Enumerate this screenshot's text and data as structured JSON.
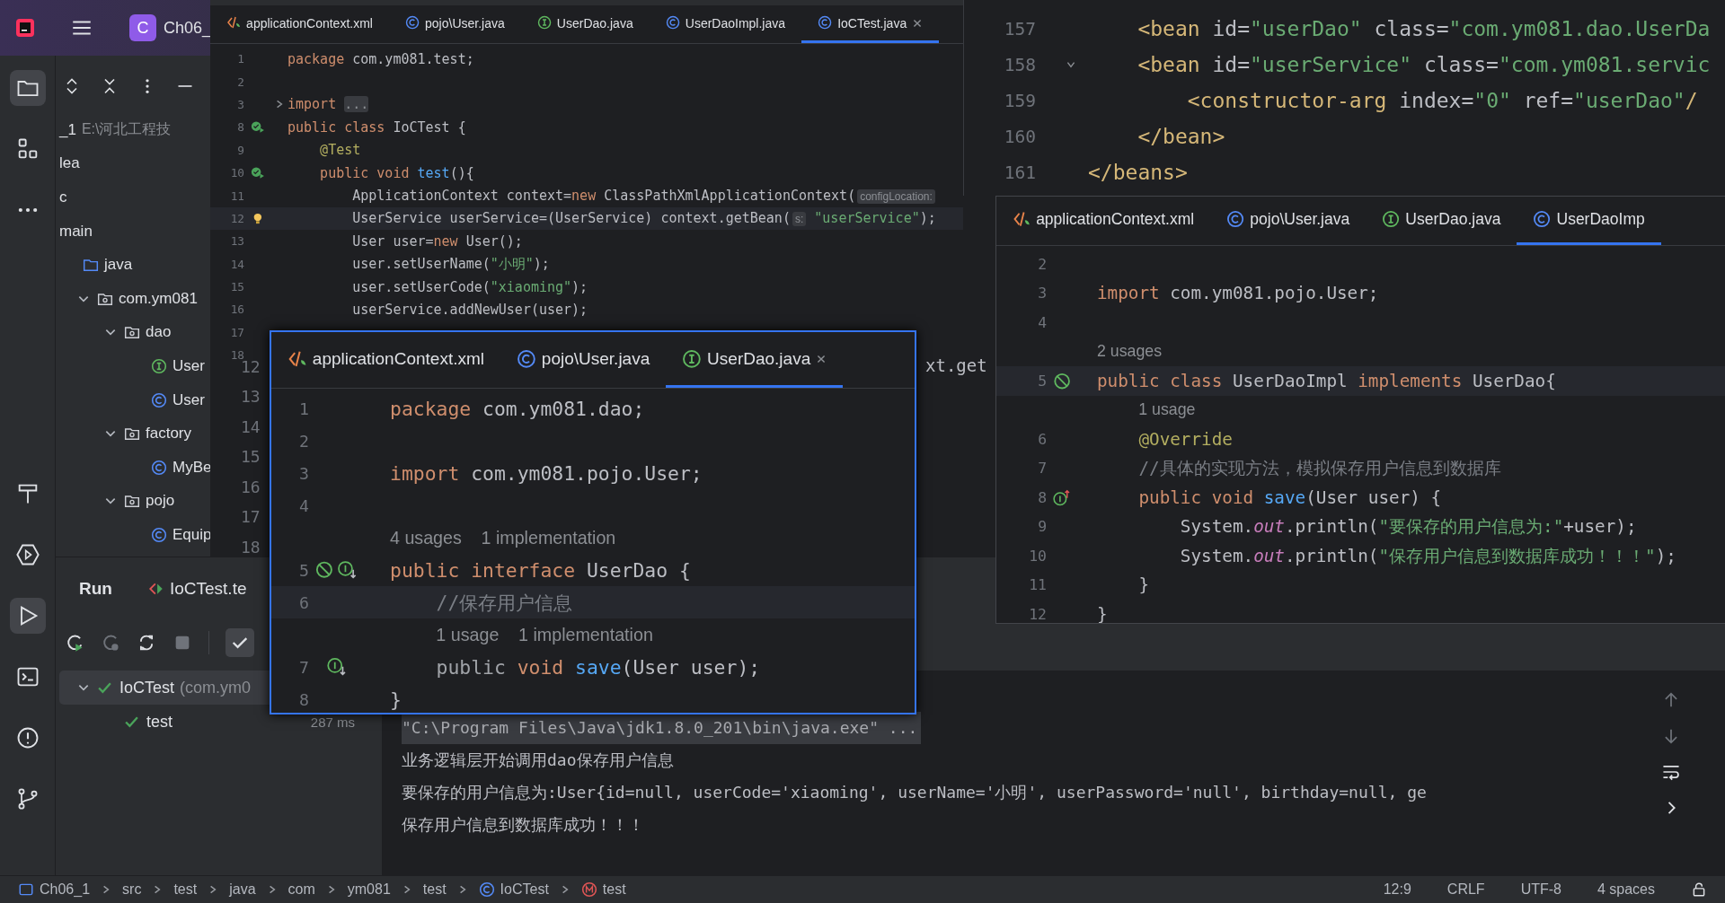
{
  "title_bar": {
    "project_badge": "C",
    "project_name": "Ch06_"
  },
  "project_panel": {
    "tree": [
      {
        "label": "_1",
        "note": "E:\\河北工程技"
      },
      {
        "label": "lea"
      },
      {
        "label": "c"
      },
      {
        "label": "main"
      },
      {
        "label": "java",
        "kind": "source",
        "children": [
          {
            "label": "com.ym081",
            "kind": "package",
            "expanded": true,
            "children": [
              {
                "label": "dao",
                "kind": "package",
                "expanded": true,
                "children": [
                  {
                    "label": "User",
                    "kind": "interface"
                  },
                  {
                    "label": "User",
                    "kind": "class"
                  }
                ]
              },
              {
                "label": "factory",
                "kind": "package",
                "expanded": true,
                "children": [
                  {
                    "label": "MyBe",
                    "kind": "class"
                  }
                ]
              },
              {
                "label": "pojo",
                "kind": "package",
                "expanded": true,
                "children": [
                  {
                    "label": "Equip",
                    "kind": "class"
                  }
                ]
              }
            ]
          }
        ]
      }
    ]
  },
  "background_editor": {
    "line_numbers": [
      "12",
      "13",
      "14",
      "15",
      "16",
      "17",
      "18"
    ],
    "fragment": "xt.get"
  },
  "editor_main": {
    "tabs": [
      {
        "label": "applicationContext.xml",
        "kind": "xml",
        "selected": false,
        "closable": false
      },
      {
        "label": "pojo\\User.java",
        "kind": "class",
        "selected": false,
        "closable": false
      },
      {
        "label": "UserDao.java",
        "kind": "interface",
        "selected": false,
        "closable": false
      },
      {
        "label": "UserDaoImpl.java",
        "kind": "class",
        "selected": false,
        "closable": false
      },
      {
        "label": "IoCTest.java",
        "kind": "class",
        "selected": true,
        "closable": true
      }
    ],
    "lines": [
      {
        "kind": "code",
        "num": "1",
        "current": false,
        "tokens": [
          {
            "text": "package",
            "kind": "kw"
          },
          {
            "text": " com.ym081.test;",
            "kind": "pl"
          }
        ]
      },
      {
        "kind": "code",
        "num": "2",
        "current": false
      },
      {
        "kind": "code",
        "num": "3",
        "current": false,
        "folded": true,
        "tokens": [
          {
            "text": "import ",
            "kind": "kw"
          },
          {
            "text": "...",
            "kind": "fold"
          }
        ]
      },
      {
        "kind": "code",
        "num": "8",
        "current": false,
        "gutter": {
          "kind": "run"
        },
        "tokens": [
          {
            "text": "public class",
            "kind": "kw"
          },
          {
            "text": " IoCTest {",
            "kind": "pl"
          }
        ]
      },
      {
        "kind": "code",
        "num": "9",
        "current": false,
        "tokens": [
          {
            "text": "    @Test",
            "kind": "ann"
          }
        ]
      },
      {
        "kind": "code",
        "num": "10",
        "current": false,
        "gutter": {
          "kind": "run"
        },
        "tokens": [
          {
            "text": "    public void ",
            "kind": "kw"
          },
          {
            "text": "test",
            "kind": "fn"
          },
          {
            "text": "(){",
            "kind": "pl"
          }
        ]
      },
      {
        "kind": "code",
        "num": "11",
        "current": false,
        "tokens": [
          {
            "text": "        ApplicationContext context=",
            "kind": "pl"
          },
          {
            "text": "new",
            "kind": "kw"
          },
          {
            "text": " ClassPathXmlApplicationContext(",
            "kind": "pl"
          },
          {
            "text": "configLocation:",
            "kind": "hint"
          }
        ]
      },
      {
        "kind": "code",
        "num": "12",
        "current": true,
        "gutter": {
          "kind": "bulb"
        },
        "tokens": [
          {
            "text": "        UserService userService=(UserService) context.getBean(",
            "kind": "pl"
          },
          {
            "text": "s:",
            "kind": "hint"
          },
          {
            "text": " \"userService\"",
            "kind": "str"
          },
          {
            "text": ");",
            "kind": "pl"
          }
        ]
      },
      {
        "kind": "code",
        "num": "13",
        "current": false,
        "tokens": [
          {
            "text": "        User user=",
            "kind": "pl"
          },
          {
            "text": "new",
            "kind": "kw"
          },
          {
            "text": " User();",
            "kind": "pl"
          }
        ]
      },
      {
        "kind": "code",
        "num": "14",
        "current": false,
        "tokens": [
          {
            "text": "        user.setUserName(",
            "kind": "pl"
          },
          {
            "text": "\"小明\"",
            "kind": "str"
          },
          {
            "text": ");",
            "kind": "pl"
          }
        ]
      },
      {
        "kind": "code",
        "num": "15",
        "current": false,
        "tokens": [
          {
            "text": "        user.setUserCode(",
            "kind": "pl"
          },
          {
            "text": "\"xiaoming\"",
            "kind": "str"
          },
          {
            "text": ");",
            "kind": "pl"
          }
        ]
      },
      {
        "kind": "code",
        "num": "16",
        "current": false,
        "tokens": [
          {
            "text": "        userService.addNewUser(user);",
            "kind": "pl"
          }
        ]
      },
      {
        "kind": "code",
        "num": "17",
        "current": false
      },
      {
        "kind": "code",
        "num": "18",
        "current": false
      }
    ]
  },
  "editor_xml": {
    "lines": [
      {
        "kind": "code",
        "num": "157",
        "current": false,
        "tokens": [
          {
            "text": "    <bean",
            "kind": "tag"
          },
          {
            "text": " id=",
            "kind": "pl"
          },
          {
            "text": "\"userDao\"",
            "kind": "str"
          },
          {
            "text": " class=",
            "kind": "pl"
          },
          {
            "text": "\"com.ym081.dao.UserDa",
            "kind": "str"
          }
        ]
      },
      {
        "kind": "code",
        "num": "158",
        "current": false,
        "folded": false,
        "tokens": [
          {
            "text": "    <bean",
            "kind": "tag"
          },
          {
            "text": " id=",
            "kind": "pl"
          },
          {
            "text": "\"userService\"",
            "kind": "str"
          },
          {
            "text": " class=",
            "kind": "pl"
          },
          {
            "text": "\"com.ym081.servic",
            "kind": "str"
          }
        ]
      },
      {
        "kind": "code",
        "num": "159",
        "current": false,
        "tokens": [
          {
            "text": "        <constructor-arg",
            "kind": "tag"
          },
          {
            "text": " index=",
            "kind": "pl"
          },
          {
            "text": "\"0\"",
            "kind": "str"
          },
          {
            "text": " ref=",
            "kind": "pl"
          },
          {
            "text": "\"userDao\"",
            "kind": "str"
          },
          {
            "text": "/",
            "kind": "tag"
          }
        ]
      },
      {
        "kind": "code",
        "num": "160",
        "current": false,
        "tokens": [
          {
            "text": "    </bean>",
            "kind": "tag"
          }
        ]
      },
      {
        "kind": "code",
        "num": "161",
        "current": false,
        "tokens": [
          {
            "text": "</beans>",
            "kind": "tag"
          }
        ]
      }
    ]
  },
  "editor_impl": {
    "tabs": [
      {
        "label": "applicationContext.xml",
        "kind": "xml",
        "selected": false,
        "closable": false
      },
      {
        "label": "pojo\\User.java",
        "kind": "class",
        "selected": false,
        "closable": false
      },
      {
        "label": "UserDao.java",
        "kind": "interface",
        "selected": false,
        "closable": false
      },
      {
        "label": "UserDaoImp",
        "kind": "class",
        "selected": true,
        "closable": false
      }
    ],
    "lines": [
      {
        "kind": "code",
        "num": "2",
        "current": false
      },
      {
        "kind": "code",
        "num": "3",
        "current": false,
        "tokens": [
          {
            "text": "import",
            "kind": "kw"
          },
          {
            "text": " com.ym081.pojo.User;",
            "kind": "pl"
          }
        ]
      },
      {
        "kind": "code",
        "num": "4",
        "current": false
      },
      {
        "kind": "usage",
        "indented": false,
        "parts": [
          "2 usages"
        ]
      },
      {
        "kind": "code",
        "num": "5",
        "current": true,
        "gutter": {
          "kind": "bean"
        },
        "tokens": [
          {
            "text": "public class",
            "kind": "kw"
          },
          {
            "text": " UserDaoImpl ",
            "kind": "pl"
          },
          {
            "text": "implements",
            "kind": "kw"
          },
          {
            "text": " UserDao{",
            "kind": "pl"
          }
        ]
      },
      {
        "kind": "usage",
        "indented": true,
        "parts": [
          "1 usage"
        ]
      },
      {
        "kind": "code",
        "num": "6",
        "current": false,
        "tokens": [
          {
            "text": "    @Override",
            "kind": "ann"
          }
        ]
      },
      {
        "kind": "code",
        "num": "7",
        "current": false,
        "tokens": [
          {
            "text": "    //具体的实现方法，模拟保存用户信息到数据库",
            "kind": "cm"
          }
        ]
      },
      {
        "kind": "code",
        "num": "8",
        "current": false,
        "gutter": {
          "kind": "override"
        },
        "tokens": [
          {
            "text": "    public void ",
            "kind": "kw"
          },
          {
            "text": "save",
            "kind": "fn"
          },
          {
            "text": "(User user) {",
            "kind": "pl"
          }
        ]
      },
      {
        "kind": "code",
        "num": "9",
        "current": false,
        "tokens": [
          {
            "text": "        System.",
            "kind": "pl"
          },
          {
            "text": "out",
            "kind": "it"
          },
          {
            "text": ".println(",
            "kind": "pl"
          },
          {
            "text": "\"要保存的用户信息为:\"",
            "kind": "str"
          },
          {
            "text": "+user);",
            "kind": "pl"
          }
        ]
      },
      {
        "kind": "code",
        "num": "10",
        "current": false,
        "tokens": [
          {
            "text": "        System.",
            "kind": "pl"
          },
          {
            "text": "out",
            "kind": "it"
          },
          {
            "text": ".println(",
            "kind": "pl"
          },
          {
            "text": "\"保存用户信息到数据库成功！！！\"",
            "kind": "str"
          },
          {
            "text": ");",
            "kind": "pl"
          }
        ]
      },
      {
        "kind": "code",
        "num": "11",
        "current": false,
        "tokens": [
          {
            "text": "    }",
            "kind": "pl"
          }
        ]
      },
      {
        "kind": "code",
        "num": "12",
        "current": false,
        "tokens": [
          {
            "text": "}",
            "kind": "pl"
          }
        ]
      }
    ]
  },
  "editor_popup": {
    "tabs": [
      {
        "label": "applicationContext.xml",
        "kind": "xml",
        "selected": false,
        "closable": false
      },
      {
        "label": "pojo\\User.java",
        "kind": "class",
        "selected": false,
        "closable": false
      },
      {
        "label": "UserDao.java",
        "kind": "interface",
        "selected": true,
        "closable": true
      }
    ],
    "lines": [
      {
        "kind": "code",
        "num": "1",
        "current": false,
        "tokens": [
          {
            "text": "package",
            "kind": "kw"
          },
          {
            "text": " com.ym081.dao;",
            "kind": "pl"
          }
        ]
      },
      {
        "kind": "code",
        "num": "2",
        "current": false
      },
      {
        "kind": "code",
        "num": "3",
        "current": false,
        "tokens": [
          {
            "text": "import",
            "kind": "kw"
          },
          {
            "text": " com.ym081.pojo.User;",
            "kind": "pl"
          }
        ]
      },
      {
        "kind": "code",
        "num": "4",
        "current": false
      },
      {
        "kind": "usage",
        "indented": false,
        "parts": [
          "4 usages",
          "1 implementation"
        ]
      },
      {
        "kind": "code",
        "num": "5",
        "current": false,
        "gutter": {
          "kind": "bean-impl"
        },
        "tokens": [
          {
            "text": "public interface",
            "kind": "kw"
          },
          {
            "text": " UserDao {",
            "kind": "pl"
          }
        ]
      },
      {
        "kind": "code",
        "num": "6",
        "current": true,
        "tokens": [
          {
            "text": "    //保存用户信息",
            "kind": "cm"
          }
        ]
      },
      {
        "kind": "usage",
        "indented": true,
        "parts": [
          "1 usage",
          "1 implementation"
        ]
      },
      {
        "kind": "code",
        "num": "7",
        "current": false,
        "gutter": {
          "kind": "impl"
        },
        "tokens": [
          {
            "text": "    public",
            "kind": "dim"
          },
          {
            "text": " void ",
            "kind": "kw"
          },
          {
            "text": "save",
            "kind": "fn"
          },
          {
            "text": "(User user);",
            "kind": "pl"
          }
        ]
      },
      {
        "kind": "code",
        "num": "8",
        "current": false,
        "tokens": [
          {
            "text": "}",
            "kind": "pl"
          }
        ]
      }
    ]
  },
  "run_panel": {
    "tabs": [
      {
        "label": "Run",
        "selected": true
      },
      {
        "label": "IoCTest.te",
        "selected": false
      }
    ],
    "tests": [
      {
        "label": "IoCTest",
        "detail": "(com.ym0",
        "passed": true,
        "expanded": true,
        "children": [
          {
            "label": "test",
            "time": "287 ms",
            "passed": true
          }
        ]
      }
    ],
    "console": [
      {
        "kind": "command",
        "text": "\"C:\\Program Files\\Java\\jdk1.8.0_201\\bin\\java.exe\" ..."
      },
      {
        "kind": "output",
        "text": "业务逻辑层开始调用dao保存用户信息"
      },
      {
        "kind": "output",
        "text": "要保存的用户信息为:User{id=null, userCode='xiaoming', userName='小明', userPassword='null', birthday=null, ge"
      },
      {
        "kind": "output",
        "text": "保存用户信息到数据库成功！！！"
      }
    ]
  },
  "status_bar": {
    "breadcrumbs": [
      {
        "label": "Ch06_1",
        "kind": "module"
      },
      {
        "label": "src"
      },
      {
        "label": "test"
      },
      {
        "label": "java"
      },
      {
        "label": "com"
      },
      {
        "label": "ym081"
      },
      {
        "label": "test"
      },
      {
        "label": "IoCTest",
        "kind": "class"
      },
      {
        "label": "test",
        "kind": "method"
      }
    ],
    "items": [
      "12:9",
      "CRLF",
      "UTF-8",
      "4 spaces"
    ]
  }
}
